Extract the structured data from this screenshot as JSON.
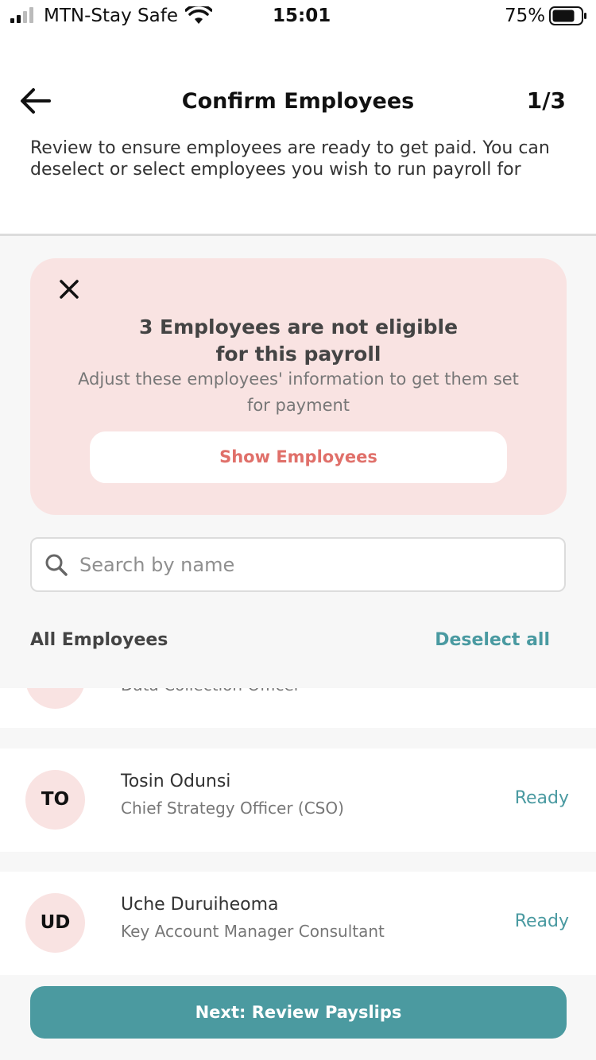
{
  "status_bar": {
    "carrier": "MTN-Stay Safe",
    "time": "15:01",
    "battery": "75%"
  },
  "header": {
    "title": "Confirm Employees",
    "step": "1/3"
  },
  "intro": "Review to ensure employees are ready to get paid. You can deselect or select employees you wish to run payroll for",
  "alert": {
    "title_line1": "3 Employees are not eligible",
    "title_line2": "for this payroll",
    "subtitle": "Adjust these employees' information to get them set for payment",
    "button_label": "Show Employees"
  },
  "search": {
    "placeholder": "Search by name"
  },
  "list": {
    "title": "All Employees",
    "deselect_label": "Deselect all",
    "partial_role": "Data Collection Officer",
    "employees": [
      {
        "initials": "TO",
        "name": "Tosin Odunsi",
        "role": "Chief Strategy Officer (CSO)",
        "status": "Ready"
      },
      {
        "initials": "UD",
        "name": "Uche Duruiheoma",
        "role": "Key Account Manager Consultant",
        "status": "Ready"
      }
    ]
  },
  "footer": {
    "next_label": "Next: Review Payslips"
  },
  "colors": {
    "accent": "#4b9aa0",
    "alert_bg": "#f9e3e2",
    "alert_button_text": "#e0706a"
  }
}
